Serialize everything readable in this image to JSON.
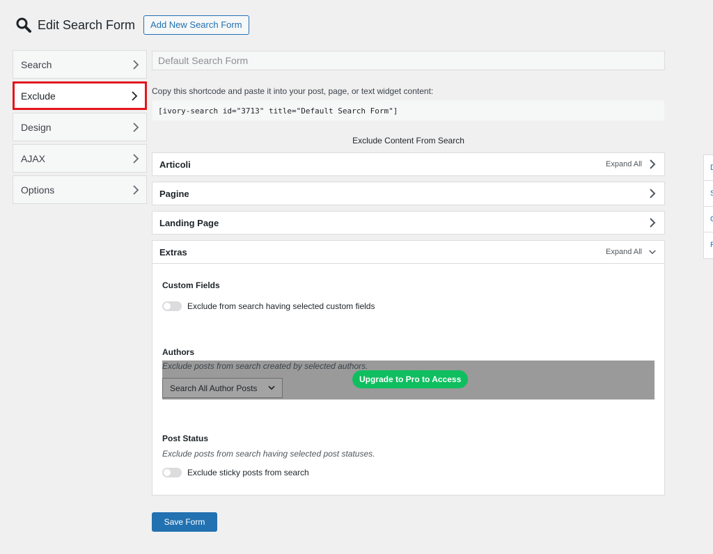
{
  "header": {
    "title": "Edit Search Form",
    "add_new_label": "Add New Search Form"
  },
  "tabs": [
    {
      "label": "Search"
    },
    {
      "label": "Exclude",
      "active": true
    },
    {
      "label": "Design"
    },
    {
      "label": "AJAX"
    },
    {
      "label": "Options"
    }
  ],
  "form": {
    "title_placeholder": "Default Search Form",
    "shortcode_label": "Copy this shortcode and paste it into your post, page, or text widget content:",
    "shortcode": "[ivory-search id=\"3713\" title=\"Default Search Form\"]",
    "section_heading": "Exclude Content From Search"
  },
  "accordions": {
    "articoli": {
      "title": "Articoli",
      "expand_all": "Expand All"
    },
    "pagine": {
      "title": "Pagine"
    },
    "landing": {
      "title": "Landing Page"
    },
    "extras": {
      "title": "Extras",
      "expand_all": "Expand All"
    }
  },
  "extras": {
    "custom_fields": {
      "title": "Custom Fields",
      "toggle_label": "Exclude from search having selected custom fields"
    },
    "authors": {
      "title": "Authors",
      "description": "Exclude posts from search created by selected authors.",
      "select_value": "Search All Author Posts",
      "upgrade_label": "Upgrade to Pro to Access"
    },
    "post_status": {
      "title": "Post Status",
      "description": "Exclude posts from search having selected post statuses.",
      "toggle_label": "Exclude sticky posts from search"
    }
  },
  "save_label": "Save Form",
  "side_panel": [
    "D",
    "S",
    "C",
    "F"
  ],
  "colors": {
    "accent": "#2271b1",
    "active_outline": "#e2161b",
    "upgrade": "#0fbe5f"
  }
}
